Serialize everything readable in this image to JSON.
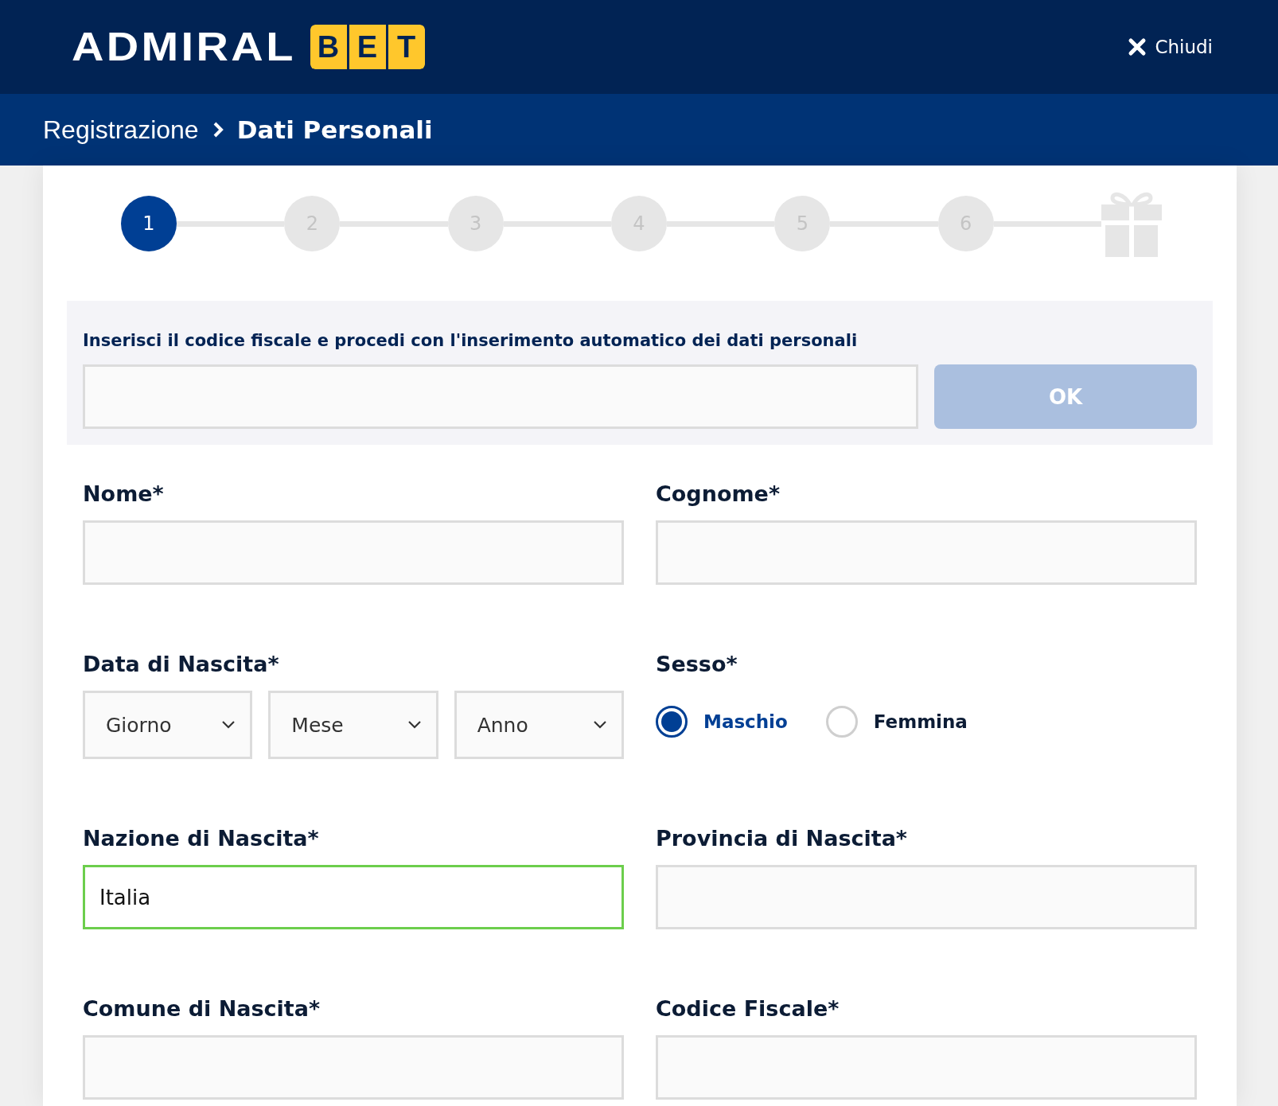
{
  "header": {
    "logo": {
      "text": "ADMIRAL",
      "badge": [
        "B",
        "E",
        "T"
      ]
    },
    "close": {
      "label": "Chiudi"
    }
  },
  "breadcrumb": [
    {
      "label": "Registrazione",
      "current": false
    },
    {
      "label": "Dati Personali",
      "current": true
    }
  ],
  "stepper": {
    "steps": [
      {
        "label": "1",
        "selected": true
      },
      {
        "label": "2",
        "selected": false
      },
      {
        "label": "3",
        "selected": false
      },
      {
        "label": "4",
        "selected": false
      },
      {
        "label": "5",
        "selected": false
      },
      {
        "label": "6",
        "selected": false
      }
    ]
  },
  "fiscal_lookup": {
    "prompt": "Inserisci il codice fiscale e procedi con l'inserimento automatico dei dati personali",
    "button": {
      "label": "OK",
      "disabled": true
    }
  },
  "fields": [
    {
      "kind": "text",
      "label": "Nome*",
      "valid": false
    },
    {
      "kind": "text",
      "label": "Cognome*",
      "valid": false
    },
    {
      "kind": "date",
      "label": "Data di Nascita*",
      "selects": [
        {
          "value": "Giorno"
        },
        {
          "value": "Mese"
        },
        {
          "value": "Anno"
        }
      ]
    },
    {
      "kind": "radio",
      "label": "Sesso*",
      "options": [
        {
          "label": "Maschio",
          "selected": true
        },
        {
          "label": "Femmina",
          "selected": false
        }
      ]
    },
    {
      "kind": "text",
      "label": "Nazione di Nascita*",
      "value": "Italia",
      "valid": true
    },
    {
      "kind": "text",
      "label": "Provincia di Nascita*",
      "valid": false
    },
    {
      "kind": "text",
      "label": "Comune di Nascita*",
      "valid": false
    },
    {
      "kind": "text",
      "label": "Codice Fiscale*",
      "valid": false
    }
  ]
}
